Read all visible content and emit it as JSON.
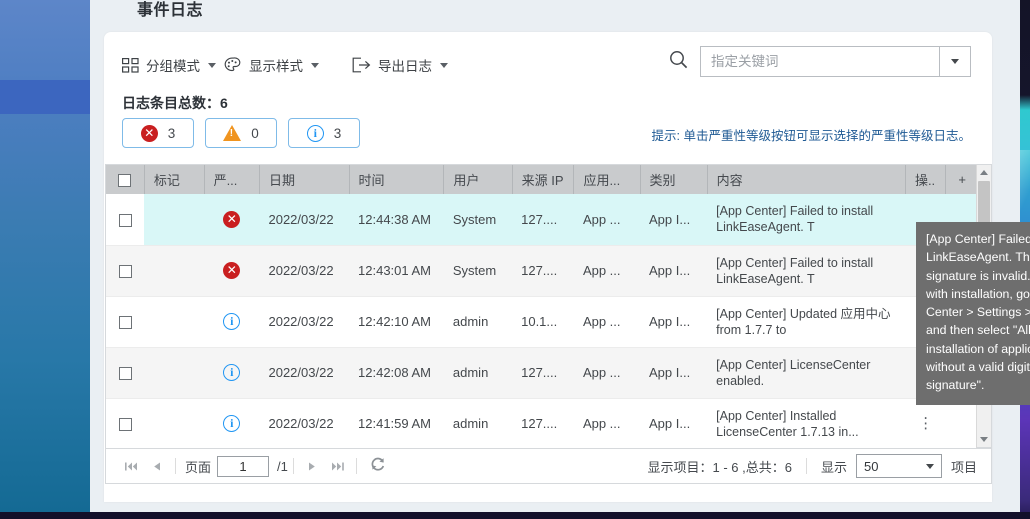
{
  "page": {
    "title": "事件日志"
  },
  "toolbar": {
    "group_mode": "分组模式",
    "view_style": "显示样式",
    "export_log": "导出日志",
    "group_mode_icon": "grid-icon",
    "view_style_icon": "palette-icon",
    "export_log_icon": "export-arrow-icon",
    "search_icon": "search-icon",
    "search_placeholder": "指定关键词",
    "search_value": ""
  },
  "summary": {
    "total_label": "日志条目总数：6"
  },
  "severity_filters": [
    {
      "name": "error",
      "icon": "error-circle-icon",
      "count": "3",
      "color": "#c91f20"
    },
    {
      "name": "warning",
      "icon": "warning-triangle-icon",
      "count": "0",
      "color": "#f0941f"
    },
    {
      "name": "info",
      "icon": "info-circle-icon",
      "count": "3",
      "color": "#2196f3"
    }
  ],
  "hint": {
    "text": "提示: 单击严重性等级按钮可显示选择的严重性等级日志。",
    "color": "#1f5a94"
  },
  "table": {
    "headers": [
      "",
      "标记",
      "严...",
      "日期",
      "时间",
      "用户",
      "来源 IP",
      "应用...",
      "类别",
      "内容",
      "操..",
      "+"
    ],
    "rows": [
      {
        "severity": "error",
        "date": "2022/03/22",
        "time": "12:44:38 AM",
        "user": "System",
        "source_ip": "127....",
        "app": "App ...",
        "category": "App I...",
        "content": "[App Center] Failed to install LinkEaseAgent. T",
        "action": ""
      },
      {
        "severity": "error",
        "date": "2022/03/22",
        "time": "12:43:01 AM",
        "user": "System",
        "source_ip": "127....",
        "app": "App ...",
        "category": "App I...",
        "content": "[App Center] Failed to install LinkEaseAgent. T",
        "action": ""
      },
      {
        "severity": "info",
        "date": "2022/03/22",
        "time": "12:42:10 AM",
        "user": "admin",
        "source_ip": "10.1...",
        "app": "App ...",
        "category": "App I...",
        "content": "[App Center] Updated 应用中心 from 1.7.7 to",
        "action": ""
      },
      {
        "severity": "info",
        "date": "2022/03/22",
        "time": "12:42:08 AM",
        "user": "admin",
        "source_ip": "127....",
        "app": "App ...",
        "category": "App I...",
        "content": "[App Center] LicenseCenter enabled.",
        "action": ""
      },
      {
        "severity": "info",
        "date": "2022/03/22",
        "time": "12:41:59 AM",
        "user": "admin",
        "source_ip": "127....",
        "app": "App ...",
        "category": "App I...",
        "content": "[App Center] Installed LicenseCenter 1.7.13 in...",
        "action": "⋮"
      }
    ]
  },
  "tooltip": {
    "text": "[App Center] Failed to install LinkEaseAgent. The digital signature is invalid. To proceed with installation, go to App Center > Settings > General, and then select \"Allow installation of applications without a valid digital signature\"."
  },
  "pager": {
    "first_icon": "first-page-icon",
    "prev_icon": "previous-page-icon",
    "next_icon": "next-page-icon",
    "last_icon": "last-page-icon",
    "refresh_icon": "refresh-icon",
    "page_label": "页面",
    "page_value": "1",
    "page_total": "/1",
    "range_text": "显示项目：1 - 6 ,总共：6",
    "show_label": "显示",
    "page_size": "50",
    "items_label": "项目"
  },
  "colors": {
    "accent_blue": "#2196f3",
    "error_red": "#c91f20",
    "error_text": "#e04a46",
    "warning_orange": "#f0941f",
    "hover_row": "#d9f7f7",
    "sidebar_top": "#5d86c9",
    "sidebar_bottom": "#146a94"
  }
}
